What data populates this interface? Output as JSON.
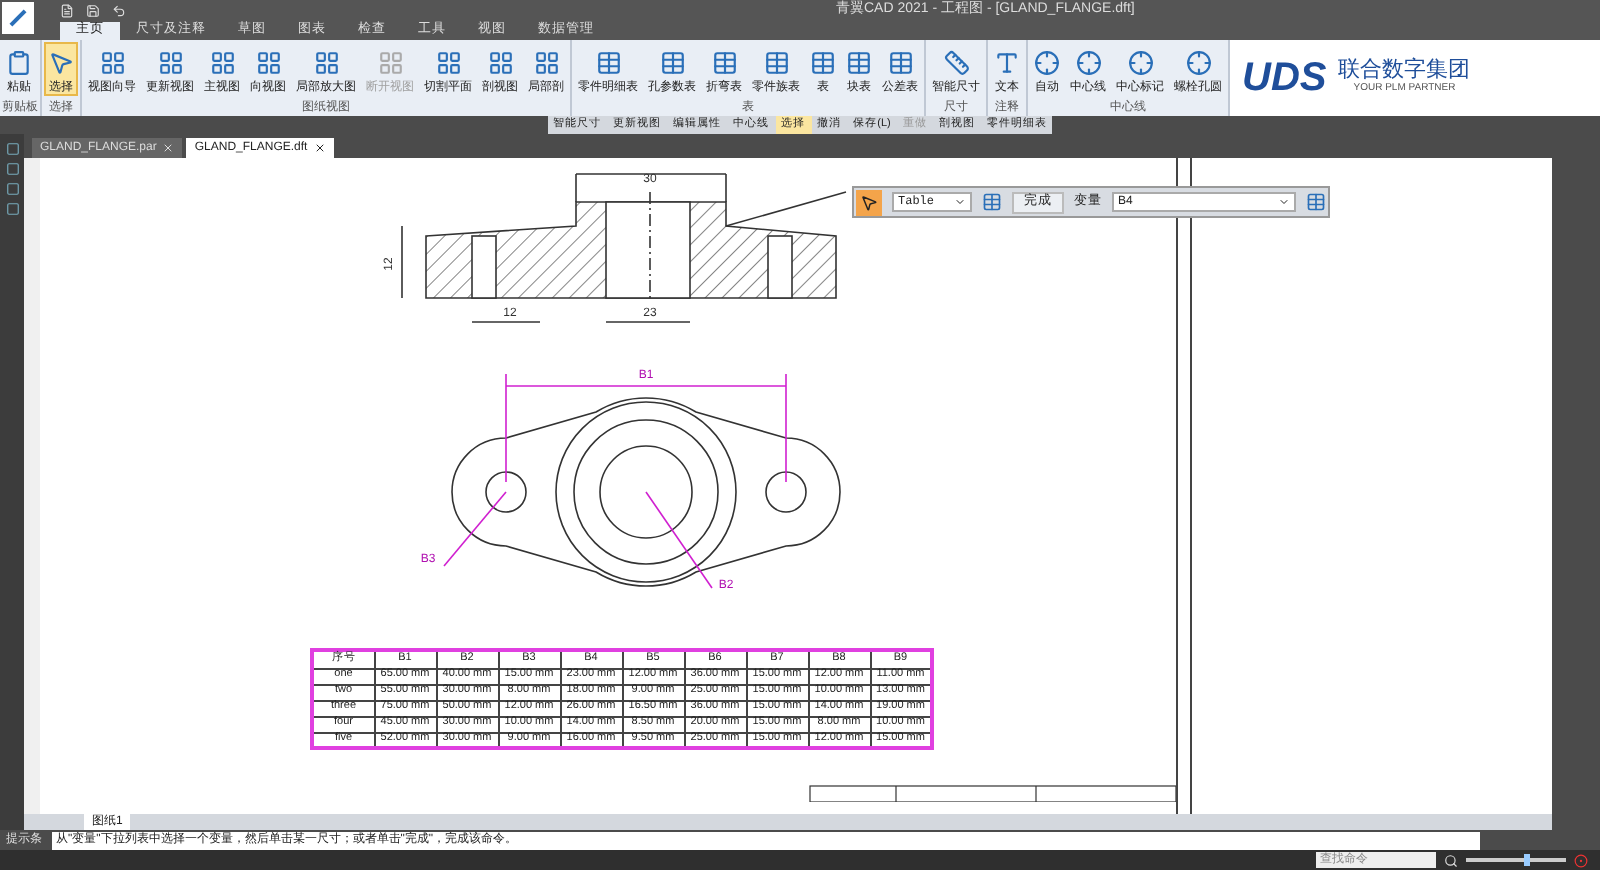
{
  "title_bar": {
    "title": "青翼CAD 2021 - 工程图 - [GLAND_FLANGE.dft]"
  },
  "ribbon_tabs": [
    {
      "label": "主页",
      "selected": true
    },
    {
      "label": "尺寸及注释",
      "selected": false
    },
    {
      "label": "草图",
      "selected": false
    },
    {
      "label": "图表",
      "selected": false
    },
    {
      "label": "检查",
      "selected": false
    },
    {
      "label": "工具",
      "selected": false
    },
    {
      "label": "视图",
      "selected": false
    },
    {
      "label": "数据管理",
      "selected": false
    }
  ],
  "ribbon_groups": [
    {
      "title": "剪贴板",
      "buttons": [
        {
          "label": "粘贴",
          "selected": false,
          "disabled": false
        }
      ]
    },
    {
      "title": "选择",
      "buttons": [
        {
          "label": "选择",
          "selected": true,
          "disabled": false
        }
      ]
    },
    {
      "title": "图纸视图",
      "buttons": [
        {
          "label": "视图向导",
          "selected": false,
          "disabled": false
        },
        {
          "label": "更新视图",
          "selected": false,
          "disabled": false
        },
        {
          "label": "主视图",
          "selected": false,
          "disabled": false
        },
        {
          "label": "向视图",
          "selected": false,
          "disabled": false
        },
        {
          "label": "局部放大图",
          "selected": false,
          "disabled": false
        },
        {
          "label": "断开视图",
          "selected": false,
          "disabled": true
        },
        {
          "label": "切割平面",
          "selected": false,
          "disabled": false
        },
        {
          "label": "剖视图",
          "selected": false,
          "disabled": false
        },
        {
          "label": "局部剖",
          "selected": false,
          "disabled": false
        }
      ]
    },
    {
      "title": "表",
      "buttons": [
        {
          "label": "零件明细表",
          "selected": false,
          "disabled": false
        },
        {
          "label": "孔参数表",
          "selected": false,
          "disabled": false
        },
        {
          "label": "折弯表",
          "selected": false,
          "disabled": false
        },
        {
          "label": "零件族表",
          "selected": false,
          "disabled": false
        },
        {
          "label": "表",
          "selected": false,
          "disabled": false
        },
        {
          "label": "块表",
          "selected": false,
          "disabled": false
        },
        {
          "label": "公差表",
          "selected": false,
          "disabled": false
        }
      ]
    },
    {
      "title": "尺寸",
      "buttons": [
        {
          "label": "智能尺寸",
          "selected": false,
          "disabled": false
        }
      ]
    },
    {
      "title": "注释",
      "buttons": [
        {
          "label": "文本",
          "selected": false,
          "disabled": false
        }
      ]
    },
    {
      "title": "中心线",
      "buttons": [
        {
          "label": "自动",
          "selected": false,
          "disabled": false
        },
        {
          "label": "中心线",
          "selected": false,
          "disabled": false
        },
        {
          "label": "中心标记",
          "selected": false,
          "disabled": false
        },
        {
          "label": "螺栓孔圆",
          "selected": false,
          "disabled": false
        }
      ]
    }
  ],
  "logo": {
    "brand": "UDS",
    "name": "联合数字集团",
    "tagline": "YOUR PLM PARTNER"
  },
  "command_bar": [
    {
      "label": "智能尺寸",
      "selected": false,
      "disabled": false
    },
    {
      "label": "更新视图",
      "selected": false,
      "disabled": false
    },
    {
      "label": "编辑属性",
      "selected": false,
      "disabled": false
    },
    {
      "label": "中心线",
      "selected": false,
      "disabled": false
    },
    {
      "label": "选择",
      "selected": true,
      "disabled": false
    },
    {
      "label": "撤消",
      "selected": false,
      "disabled": false
    },
    {
      "label": "保存(L)",
      "selected": false,
      "disabled": false
    },
    {
      "label": "重做",
      "selected": false,
      "disabled": true
    },
    {
      "label": "剖视图",
      "selected": false,
      "disabled": false
    },
    {
      "label": "零件明细表",
      "selected": false,
      "disabled": false
    }
  ],
  "document_tabs": [
    {
      "label": "GLAND_FLANGE.par",
      "selected": false
    },
    {
      "label": "GLAND_FLANGE.dft",
      "selected": true
    }
  ],
  "float_toolbar": {
    "type_value": "Table",
    "finish_button": "完成",
    "variable_label": "变量",
    "variable_value": "B4"
  },
  "drawing": {
    "labels": [
      "30",
      "12",
      "12",
      "23",
      "B1",
      "B3",
      "B2"
    ]
  },
  "table": {
    "columns": [
      "序号",
      "B1",
      "B2",
      "B3",
      "B4",
      "B5",
      "B6",
      "B7",
      "B8",
      "B9"
    ],
    "rows": [
      [
        "one",
        "65.00 mm",
        "40.00 mm",
        "15.00 mm",
        "23.00 mm",
        "12.00 mm",
        "36.00 mm",
        "15.00 mm",
        "12.00 mm",
        "11.00 mm"
      ],
      [
        "two",
        "55.00 mm",
        "30.00 mm",
        "8.00 mm",
        "18.00 mm",
        "9.00 mm",
        "25.00 mm",
        "15.00 mm",
        "10.00 mm",
        "13.00 mm"
      ],
      [
        "three",
        "75.00 mm",
        "50.00 mm",
        "12.00 mm",
        "26.00 mm",
        "16.50 mm",
        "36.00 mm",
        "15.00 mm",
        "14.00 mm",
        "19.00 mm"
      ],
      [
        "four",
        "45.00 mm",
        "30.00 mm",
        "10.00 mm",
        "14.00 mm",
        "8.50 mm",
        "20.00 mm",
        "15.00 mm",
        "8.00 mm",
        "10.00 mm"
      ],
      [
        "five",
        "52.00 mm",
        "30.00 mm",
        "9.00 mm",
        "16.00 mm",
        "9.50 mm",
        "25.00 mm",
        "15.00 mm",
        "12.00 mm",
        "15.00 mm"
      ]
    ]
  },
  "sheet_tabs": [
    {
      "label": "图纸1",
      "selected": true
    }
  ],
  "prompt": {
    "label": "提示条",
    "message": "从\"变量\"下拉列表中选择一个变量，然后单击某一尺寸；或者单击\"完成\"，完成该命令。"
  },
  "status_bar": {
    "search_placeholder": "查找命令",
    "zoom_slider": {
      "level": 0.6
    }
  }
}
